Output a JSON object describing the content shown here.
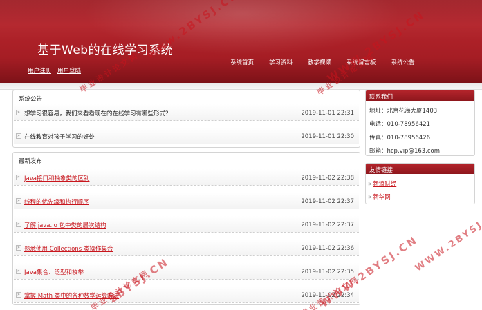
{
  "header": {
    "site_title": "基于Web的在线学习系统",
    "user_links": [
      "用户注册",
      "用户登陆"
    ],
    "nav": [
      "系统首页",
      "学习资料",
      "教学视频",
      "系统留言板",
      "系统公告"
    ]
  },
  "announcements": {
    "title": "系统公告",
    "items": [
      {
        "title": "想学习很容易，我们来看看现在的在线学习有哪些形式？",
        "date": "2019-11-01 22:31"
      },
      {
        "title": "在线教育对孩子学习的好处",
        "date": "2019-11-01 22:30"
      }
    ]
  },
  "latest": {
    "title": "最新发布",
    "items": [
      {
        "title": "Java接口和抽象类的区别",
        "date": "2019-11-02 22:38"
      },
      {
        "title": "线程的优先级和执行顺序",
        "date": "2019-11-02 22:37"
      },
      {
        "title": "了解 java.io 包中类的层次结构",
        "date": "2019-11-02 22:37"
      },
      {
        "title": "熟悉使用 Collections 类操作集合",
        "date": "2019-11-02 22:36"
      },
      {
        "title": "Java集合、泛型和枚举",
        "date": "2019-11-02 22:35"
      },
      {
        "title": "掌握 Math 类中的各种数学运算方法",
        "date": "2019-11-02 22:34"
      }
    ]
  },
  "contact": {
    "title": "联系我们",
    "lines": [
      "地址：北京花海大厦1403",
      "电话：010-78956421",
      "传真：010-78956426",
      "邮箱：hcp.vip@163.com"
    ]
  },
  "friend_links": {
    "title": "友情链接",
    "items": [
      "新浪财经",
      "新华网"
    ]
  },
  "watermarks": [
    "毕业设计论文网",
    "www.2BYSJ.CN",
    "WWW.2BYSJ.CN",
    "毕业设计论文网",
    "2BYSJ.CN",
    "WWW.2BYSJ.CN",
    "毕业设计论文网",
    "WWW.2BYSJ.CN",
    "毕业设计论文网"
  ],
  "colors": {
    "brand_red": "#a51d24",
    "link_red": "#c8161d"
  }
}
